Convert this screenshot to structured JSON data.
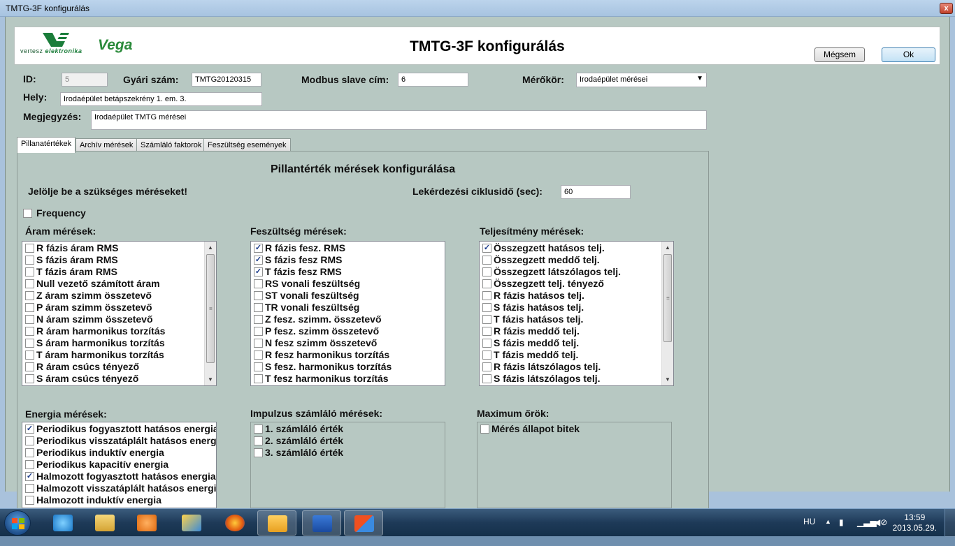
{
  "window": {
    "title": "TMTG-3F konfigurálás",
    "close": "x"
  },
  "header": {
    "logo_text_a": "vertesz ",
    "logo_text_b": "elektronika",
    "brand": "Vega",
    "title": "TMTG-3F konfigurálás",
    "cancel_label": "Mégsem",
    "ok_label": "Ok"
  },
  "form": {
    "id_label": "ID:",
    "id_value": "5",
    "serial_label": "Gyári szám:",
    "serial_value": "TMTG20120315",
    "modbus_label": "Modbus slave cím:",
    "modbus_value": "6",
    "circuit_label": "Mérőkör:",
    "circuit_value": "Irodaépület mérései",
    "place_label": "Hely:",
    "place_value": "Irodaépület betápszekrény 1. em. 3.",
    "note_label": "Megjegyzés:",
    "note_value": "Irodaépület TMTG mérései"
  },
  "tabs": [
    "Pillanatértékek",
    "Archív mérések",
    "Számláló faktorok",
    "Feszültség események"
  ],
  "panel": {
    "title": "Pillantérték mérések konfigurálása",
    "hint": "Jelölje be a szükséges méréseket!",
    "cycle_label": "Lekérdezési ciklusidő (sec):",
    "cycle_value": "60",
    "frequency_label": "Frequency",
    "frequency_checked": false
  },
  "groups": {
    "aram": {
      "label": "Áram mérések:",
      "items": [
        {
          "t": "R fázis áram RMS",
          "c": false
        },
        {
          "t": "S fázis áram RMS",
          "c": false
        },
        {
          "t": "T fázis áram RMS",
          "c": false
        },
        {
          "t": "Null vezető számított áram",
          "c": false
        },
        {
          "t": "Z áram szimm összetevő",
          "c": false
        },
        {
          "t": "P áram szimm összetevő",
          "c": false
        },
        {
          "t": "N áram szimm összetevő",
          "c": false
        },
        {
          "t": "R áram harmonikus torzítás",
          "c": false
        },
        {
          "t": "S áram harmonikus torzítás",
          "c": false
        },
        {
          "t": "T áram harmonikus torzítás",
          "c": false
        },
        {
          "t": "R áram csúcs tényező",
          "c": false
        },
        {
          "t": "S áram csúcs tényező",
          "c": false
        }
      ]
    },
    "fesz": {
      "label": "Feszültség mérések:",
      "items": [
        {
          "t": "R fázis fesz. RMS",
          "c": true
        },
        {
          "t": "S fázis fesz RMS",
          "c": true
        },
        {
          "t": "T fázis fesz RMS",
          "c": true
        },
        {
          "t": "RS vonali feszültség",
          "c": false
        },
        {
          "t": "ST vonali feszültség",
          "c": false
        },
        {
          "t": "TR vonali feszültség",
          "c": false
        },
        {
          "t": "Z fesz. szimm. összetevő",
          "c": false
        },
        {
          "t": "P fesz. szimm összetevő",
          "c": false
        },
        {
          "t": "N fesz szimm összetevő",
          "c": false
        },
        {
          "t": "R fesz harmonikus torzítás",
          "c": false
        },
        {
          "t": "S fesz. harmonikus torzítás",
          "c": false
        },
        {
          "t": "T fesz harmonikus torzítás",
          "c": false
        }
      ]
    },
    "telj": {
      "label": "Teljesítmény mérések:",
      "items": [
        {
          "t": "Összegzett hatásos telj.",
          "c": true
        },
        {
          "t": "Összegzett meddő telj.",
          "c": false
        },
        {
          "t": "Összegzett látszólagos telj.",
          "c": false
        },
        {
          "t": "Összegzett telj. tényező",
          "c": false
        },
        {
          "t": "R fázis hatásos telj.",
          "c": false
        },
        {
          "t": "S fázis hatásos telj.",
          "c": false
        },
        {
          "t": "T fázis hatásos telj.",
          "c": false
        },
        {
          "t": "R fázis meddő telj.",
          "c": false
        },
        {
          "t": "S fázis meddő telj.",
          "c": false
        },
        {
          "t": "T fázis meddő telj.",
          "c": false
        },
        {
          "t": "R fázis látszólagos telj.",
          "c": false
        },
        {
          "t": "S fázis látszólagos telj.",
          "c": false
        }
      ]
    },
    "energia": {
      "label": "Energia mérések:",
      "items": [
        {
          "t": "Periodikus fogyasztott hatásos energia",
          "c": true
        },
        {
          "t": "Periodikus visszatáplált hatásos energia",
          "c": false
        },
        {
          "t": "Periodikus induktív energia",
          "c": false
        },
        {
          "t": "Periodikus kapacitív energia",
          "c": false
        },
        {
          "t": "Halmozott fogyasztott hatásos energia",
          "c": true
        },
        {
          "t": "Halmozott visszatáplált hatásos energia",
          "c": false
        },
        {
          "t": "Halmozott induktív energia",
          "c": false
        }
      ]
    },
    "impulzus": {
      "label": "Impulzus számláló mérések:",
      "items": [
        {
          "t": "1. számláló érték",
          "c": false
        },
        {
          "t": "2. számláló érték",
          "c": false
        },
        {
          "t": "3. számláló érték",
          "c": false
        }
      ]
    },
    "maximum": {
      "label": "Maximum őrök:",
      "items": [
        {
          "t": "Mérés állapot bitek",
          "c": false
        }
      ]
    }
  },
  "taskbar": {
    "lang": "HU",
    "time": "13:59",
    "date": "2013.05.29.",
    "apps": [
      "internet-explorer",
      "windows-explorer",
      "media-player",
      "paint",
      "firefox",
      "outlook",
      "word",
      "office-app"
    ],
    "colors": {
      "accent": "#3c7fb1",
      "checkmark": "#1a3a8a"
    }
  }
}
